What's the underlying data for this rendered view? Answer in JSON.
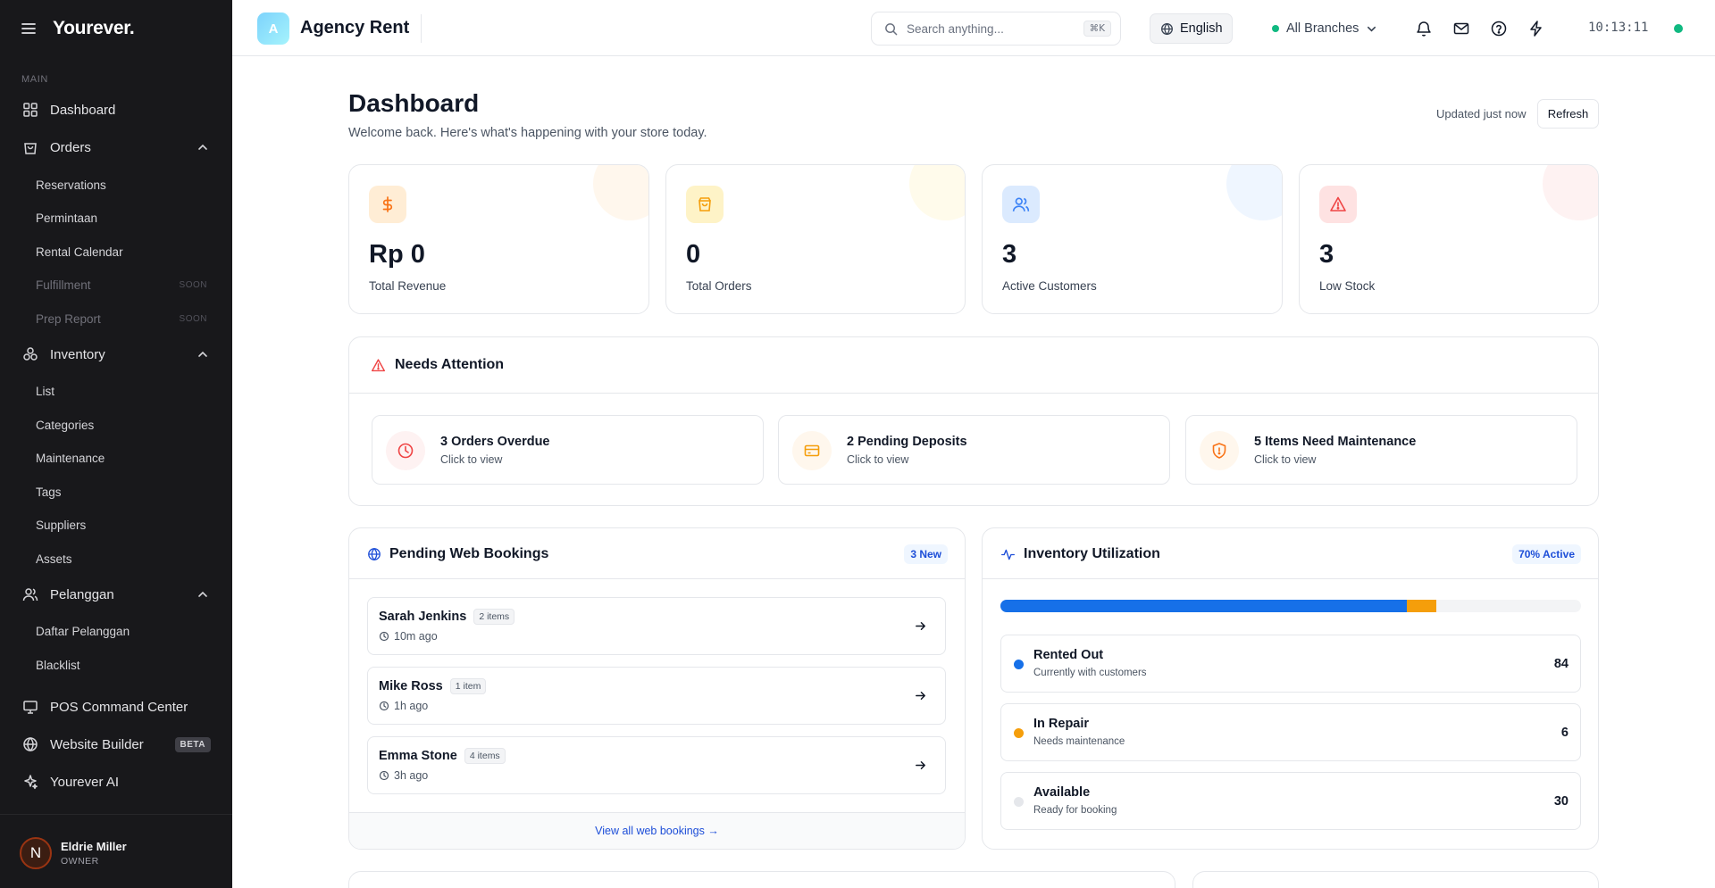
{
  "sidebar": {
    "brand": "Yourever.",
    "section": "MAIN",
    "items": {
      "dashboard": "Dashboard",
      "orders": "Orders",
      "reservations": "Reservations",
      "permintaan": "Permintaan",
      "rental_calendar": "Rental Calendar",
      "fulfillment": "Fulfillment",
      "prep_report": "Prep Report",
      "inventory": "Inventory",
      "list": "List",
      "categories": "Categories",
      "maintenance": "Maintenance",
      "tags": "Tags",
      "suppliers": "Suppliers",
      "assets": "Assets",
      "pelanggan": "Pelanggan",
      "daftar_pelanggan": "Daftar Pelanggan",
      "blacklist": "Blacklist",
      "pos": "POS Command Center",
      "website_builder": "Website Builder",
      "ai": "Yourever AI"
    },
    "soon_badge": "SOON",
    "beta_badge": "BETA",
    "user": {
      "initial": "N",
      "name": "Eldrie Miller",
      "role": "OWNER"
    }
  },
  "topbar": {
    "app_initial": "A",
    "app_name": "Agency Rent",
    "search_placeholder": "Search anything...",
    "search_shortcut": "⌘K",
    "language": "English",
    "branch": "All Branches",
    "time": "10:13:11"
  },
  "header": {
    "title": "Dashboard",
    "subtitle": "Welcome back. Here's what's happening with your store today.",
    "updated": "Updated just now",
    "refresh": "Refresh"
  },
  "stats": [
    {
      "value": "Rp 0",
      "label": "Total Revenue",
      "icon": "dollar-icon",
      "color": "#f97316"
    },
    {
      "value": "0",
      "label": "Total Orders",
      "icon": "shopping-bag-icon",
      "color": "#f59e0b"
    },
    {
      "value": "3",
      "label": "Active Customers",
      "icon": "users-icon",
      "color": "#3b82f6"
    },
    {
      "value": "3",
      "label": "Low Stock",
      "icon": "warning-icon",
      "color": "#ef4444"
    }
  ],
  "attention": {
    "title": "Needs Attention",
    "items": [
      {
        "title": "3 Orders Overdue",
        "sub": "Click to view",
        "icon": "clock-icon"
      },
      {
        "title": "2 Pending Deposits",
        "sub": "Click to view",
        "icon": "credit-card-icon"
      },
      {
        "title": "5 Items Need Maintenance",
        "sub": "Click to view",
        "icon": "shield-icon"
      }
    ]
  },
  "bookings": {
    "title": "Pending Web Bookings",
    "badge": "3 New",
    "items": [
      {
        "name": "Sarah Jenkins",
        "count": "2 items",
        "time": "10m ago"
      },
      {
        "name": "Mike Ross",
        "count": "1 item",
        "time": "1h ago"
      },
      {
        "name": "Emma Stone",
        "count": "4 items",
        "time": "3h ago"
      }
    ],
    "footer": "View all web bookings →"
  },
  "utilization": {
    "title": "Inventory Utilization",
    "badge": "70% Active",
    "bar": {
      "rented_fraction": 0.7,
      "repair_fraction": 0.05
    },
    "items": [
      {
        "title": "Rented Out",
        "sub": "Currently with customers",
        "value": "84",
        "color": "#1670e8"
      },
      {
        "title": "In Repair",
        "sub": "Needs maintenance",
        "value": "6",
        "color": "#f59e0b"
      },
      {
        "title": "Available",
        "sub": "Ready for booking",
        "value": "30",
        "color": "#e5e7eb"
      }
    ]
  }
}
